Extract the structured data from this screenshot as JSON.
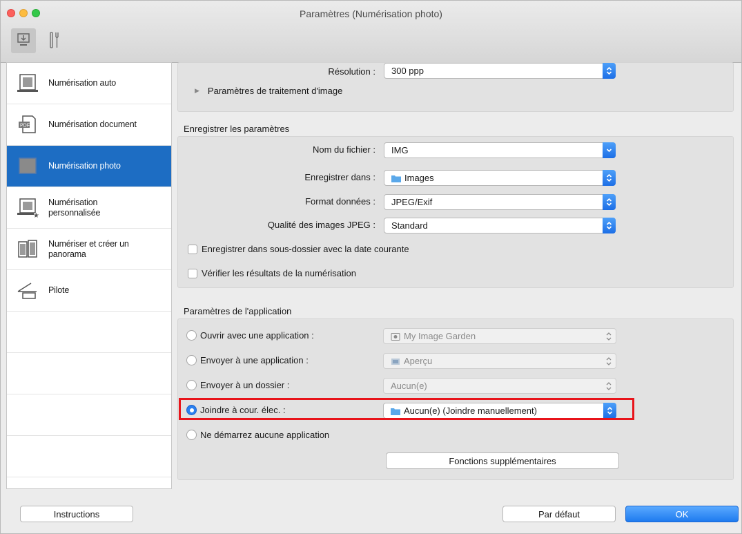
{
  "window": {
    "title": "Paramètres (Numérisation photo)"
  },
  "toolbar": {
    "items": [
      {
        "name": "scan-from-computer-tab",
        "icon": "computer-scan-icon",
        "selected": true
      },
      {
        "name": "general-settings-tab",
        "icon": "tools-icon",
        "selected": false
      }
    ]
  },
  "sidebar": {
    "items": [
      {
        "label": "Numérisation auto",
        "icon": "auto-scan-icon",
        "active": false
      },
      {
        "label": "Numérisation document",
        "icon": "pdf-document-icon",
        "active": false
      },
      {
        "label": "Numérisation photo",
        "icon": "photo-scan-icon",
        "active": true
      },
      {
        "label_line1": "Numérisation",
        "label_line2": "personnalisée",
        "icon": "custom-scan-icon",
        "active": false
      },
      {
        "label_line1": "Numériser et créer un",
        "label_line2": "panorama",
        "icon": "panorama-icon",
        "active": false
      },
      {
        "label": "Pilote",
        "icon": "driver-icon",
        "active": false
      }
    ]
  },
  "scan_options": {
    "resolution_label": "Résolution :",
    "resolution_value": "300 ppp",
    "image_processing_label": "Paramètres de traitement d'image"
  },
  "save_settings": {
    "title": "Enregistrer les paramètres",
    "file_name_label": "Nom du fichier :",
    "file_name_value": "IMG",
    "save_in_label": "Enregistrer dans :",
    "save_in_value": "Images",
    "data_format_label": "Format données :",
    "data_format_value": "JPEG/Exif",
    "jpeg_quality_label": "Qualité des images JPEG :",
    "jpeg_quality_value": "Standard",
    "subfolder_label": "Enregistrer dans sous-dossier avec la date courante",
    "subfolder_checked": false,
    "check_results_label": "Vérifier les résultats de la numérisation",
    "check_results_checked": false
  },
  "app_settings": {
    "title": "Paramètres de l'application",
    "open_with_label": "Ouvrir avec une application :",
    "open_with_value": "My Image Garden",
    "send_app_label": "Envoyer à une application :",
    "send_app_value": "Aperçu",
    "send_folder_label": "Envoyer à un dossier :",
    "send_folder_value": "Aucun(e)",
    "attach_email_label": "Joindre à cour. élec. :",
    "attach_email_value": "Aucun(e) (Joindre manuellement)",
    "no_app_label": "Ne démarrez aucune application",
    "selected_option": "attach_email",
    "more_functions_label": "Fonctions supplémentaires"
  },
  "footer": {
    "instructions_label": "Instructions",
    "defaults_label": "Par défaut",
    "ok_label": "OK"
  },
  "colors": {
    "accent": "#1d6dc3",
    "highlight_box": "#e8141b"
  }
}
